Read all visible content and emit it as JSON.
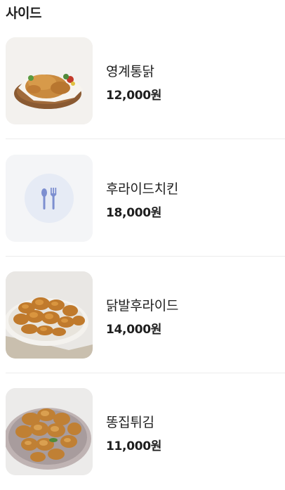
{
  "section": {
    "title": "사이드"
  },
  "items": [
    {
      "name": "영계통닭",
      "price": "12,000원",
      "image": "roast-chicken-photo"
    },
    {
      "name": "후라이드치킨",
      "price": "18,000원",
      "image": "utensils-placeholder-icon"
    },
    {
      "name": "닭발후라이드",
      "price": "14,000원",
      "image": "fried-chicken-feet-photo"
    },
    {
      "name": "똥집튀김",
      "price": "11,000원",
      "image": "fried-gizzard-photo"
    }
  ],
  "colors": {
    "text": "#1e1e1e",
    "divider": "#ececec",
    "placeholder_bg": "#f4f5f7",
    "placeholder_circle": "#e6ebf5",
    "placeholder_icon": "#7d8fd0"
  }
}
